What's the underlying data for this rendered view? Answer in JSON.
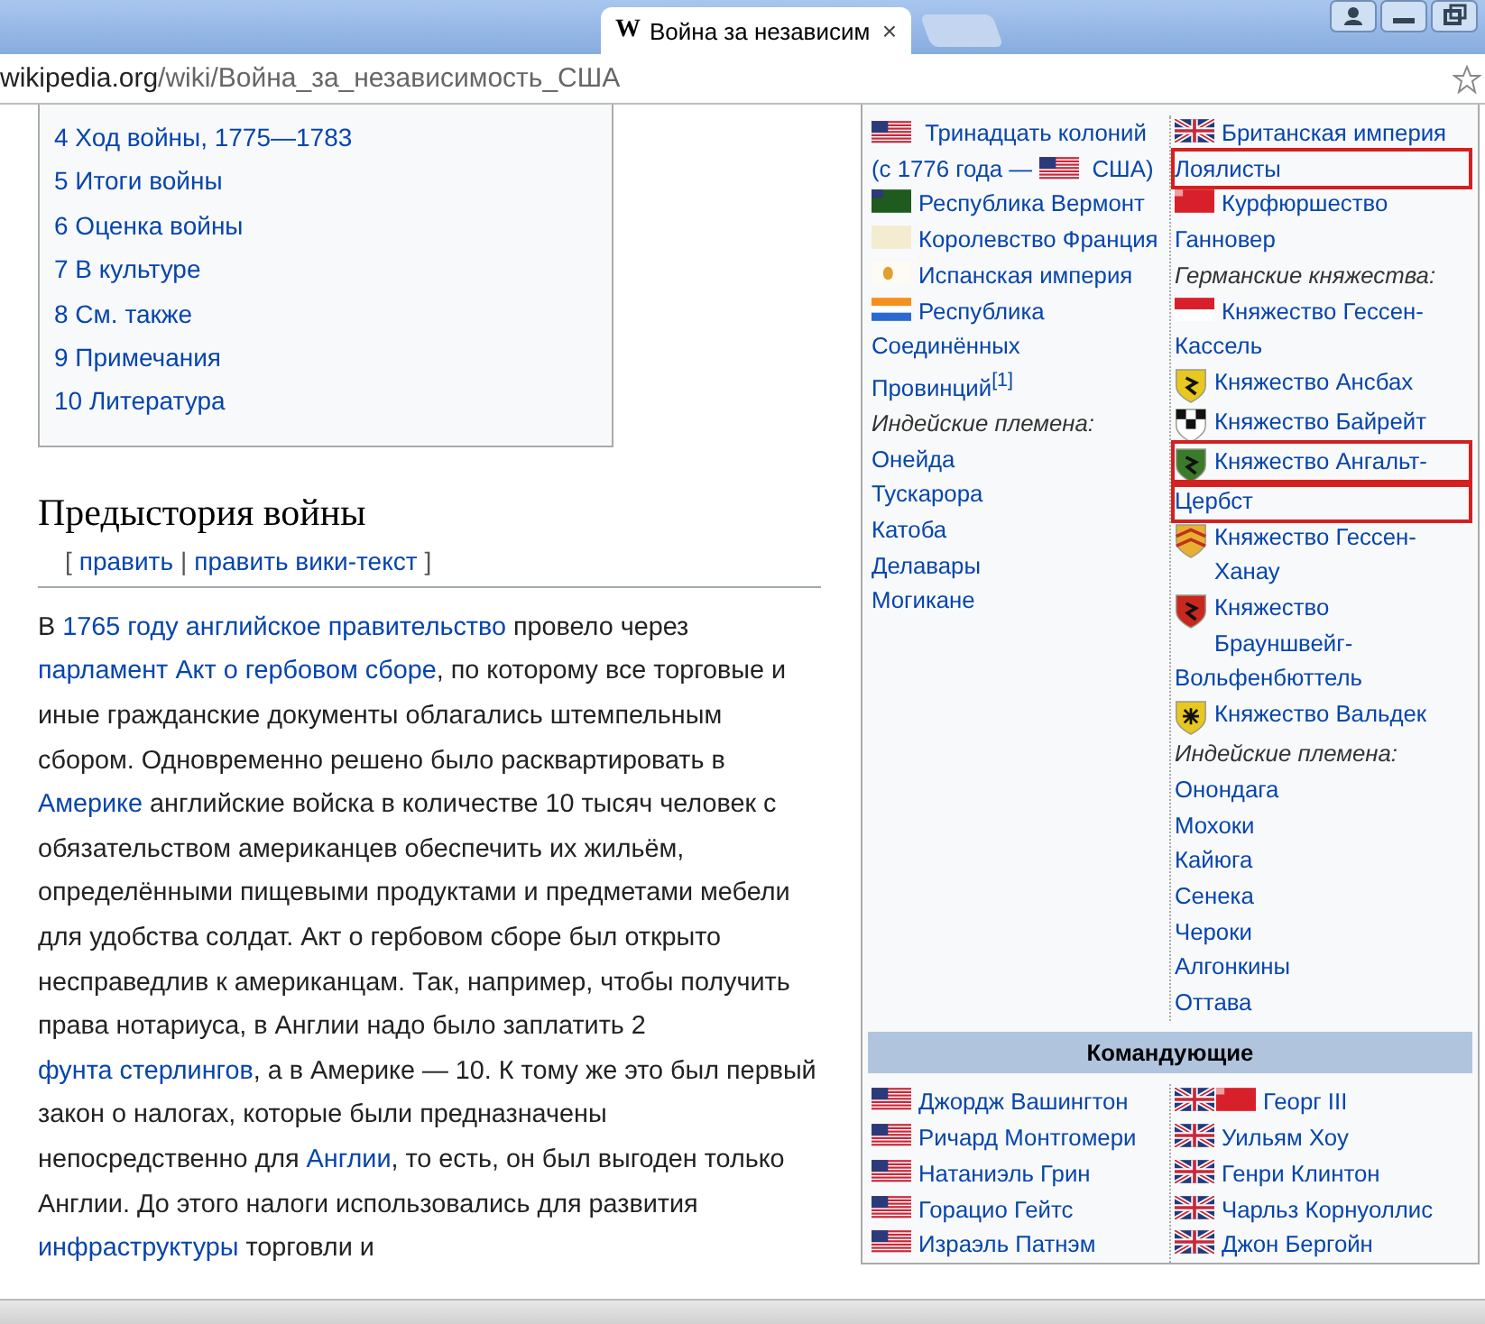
{
  "browser": {
    "tab": {
      "logo": "W",
      "title": "Война за независим",
      "close": "×",
      "selected": true
    },
    "address": {
      "host": "wikipedia.org",
      "path": "/wiki/Война_за_независимость_США"
    }
  },
  "toc": [
    "4 Ход войны, 1775—1783",
    "5 Итоги войны",
    "6 Оценка войны",
    "7 В культуре",
    "8 См. также",
    "9 Примечания",
    "10 Литература"
  ],
  "section": {
    "title": "Предыстория войны",
    "edit": {
      "open": "[",
      "separator": "|",
      "close": "]",
      "links": [
        "править",
        "править вики-текст"
      ]
    },
    "paragraph": [
      {
        "text": "В ",
        "link": false
      },
      {
        "text": "1765 году",
        "link": true,
        "space_after": true
      },
      {
        "text": "английское правительство",
        "link": true
      },
      {
        "text": " провело через ",
        "link": false
      },
      {
        "text": "парламент",
        "link": true,
        "space_after": true
      },
      {
        "text": "Акт о гербовом сборе",
        "link": true
      },
      {
        "text": ", по которому все торговые и иные гражданские документы облагались штемпельным сбором. Одновременно решено было расквартировать в ",
        "link": false
      },
      {
        "text": "Америке",
        "link": true
      },
      {
        "text": " английские войска в количестве 10 тысяч человек с обязательством американцев обеспечить их жильём, определёнными пищевыми продуктами и предметами мебели для удобства солдат. Акт о гербовом сборе был открыто несправедлив к американцам. Так, например, чтобы получить права нотариуса, в Англии надо было заплатить 2 ",
        "link": false
      },
      {
        "text": "фунта стерлингов",
        "link": true
      },
      {
        "text": ", а в Америке — 10. К тому же это был первый закон о налогах, которые были предназначены непосредственно для ",
        "link": false
      },
      {
        "text": "Англии",
        "link": true
      },
      {
        "text": ", то есть, он был выгоден только Англии. До этого налоги использовались для развития ",
        "link": false
      },
      {
        "text": "инфраструктуры",
        "link": true
      },
      {
        "text": " торговли и",
        "link": false
      }
    ]
  },
  "infobox": {
    "sides": [
      {
        "items": [
          {
            "kind": "link",
            "parts": [
              {
                "kind": "us"
              },
              {
                "text": "Тринадцать колоний"
              },
              {
                "text": "(с 1776 года —"
              },
              {
                "kind": "us"
              },
              {
                "text": "США)"
              }
            ],
            "highlighted": false
          },
          {
            "kind": "link",
            "flags": [
              {
                "kind": "vermont"
              }
            ],
            "text": "Республика Вермонт",
            "highlighted": false
          },
          {
            "kind": "link",
            "flags": [
              {
                "kind": "france"
              }
            ],
            "text": "Королевство Франция",
            "highlighted": false
          },
          {
            "kind": "link",
            "flags": [
              {
                "kind": "spain"
              }
            ],
            "text": "Испанская империя",
            "highlighted": false
          },
          {
            "kind": "link",
            "flags": [
              {
                "kind": "dutch"
              }
            ],
            "text": "Республика Соединённых Провинций$^{[1]}$",
            "highlighted": false
          },
          {
            "kind": "heading",
            "text": "Индейские племена:"
          },
          {
            "kind": "link",
            "text": "Онейда",
            "highlighted": false
          },
          {
            "kind": "link",
            "text": "Тускарора",
            "highlighted": false
          },
          {
            "kind": "link",
            "text": "Катоба",
            "highlighted": false
          },
          {
            "kind": "link",
            "text": "Делавары",
            "highlighted": false
          },
          {
            "kind": "link",
            "text": "Могикане",
            "highlighted": false
          }
        ]
      },
      {
        "items": [
          {
            "kind": "link",
            "flags": [
              {
                "kind": "uk"
              }
            ],
            "text": "Британская империя",
            "highlighted": false
          },
          {
            "kind": "link",
            "text": "Лоялисты",
            "highlighted": true
          },
          {
            "kind": "link",
            "flags": [
              {
                "kind": "hanover"
              }
            ],
            "text": "Курфюршество Ганновер",
            "highlighted": false
          },
          {
            "kind": "heading",
            "text": "Германские княжества:"
          },
          {
            "kind": "link",
            "flags": [
              {
                "kind": "hessen"
              }
            ],
            "text": "Княжество Гессен-Кассель",
            "highlighted": false
          },
          {
            "kind": "link",
            "flags": [
              {
                "kind": "ansbach"
              }
            ],
            "text": "Княжество Ансбах",
            "highlighted": false
          },
          {
            "kind": "link",
            "flags": [
              {
                "kind": "bayreuth"
              }
            ],
            "text": "Княжество Байрейт",
            "highlighted": false
          },
          {
            "kind": "link",
            "flags": [
              {
                "kind": "anhalt"
              }
            ],
            "text": "Княжество Ангальт-",
            "highlighted": true
          },
          {
            "kind": "link",
            "text": "Цербст",
            "highlighted": true
          },
          {
            "kind": "link",
            "flags": [
              {
                "kind": "hanau"
              }
            ],
            "text": "Княжество Гессен-Ханау",
            "highlighted": false
          },
          {
            "kind": "link",
            "flags": [
              {
                "kind": "brunswick"
              }
            ],
            "text": "Княжество Брауншвейг-Вольфенбюттель",
            "highlighted": false
          },
          {
            "kind": "link",
            "flags": [
              {
                "kind": "waldeck"
              }
            ],
            "text": "Княжество Вальдек",
            "highlighted": false
          },
          {
            "kind": "heading",
            "text": "Индейские племена:"
          },
          {
            "kind": "link",
            "text": "Онондага",
            "highlighted": false
          },
          {
            "kind": "link",
            "text": "Мохоки",
            "highlighted": false
          },
          {
            "kind": "link",
            "text": "Кайюга",
            "highlighted": false
          },
          {
            "kind": "link",
            "text": "Сенека",
            "highlighted": false
          },
          {
            "kind": "link",
            "text": "Чероки",
            "highlighted": false
          },
          {
            "kind": "link",
            "text": "Алгонкины",
            "highlighted": false
          },
          {
            "kind": "link",
            "text": "Оттава",
            "highlighted": false
          }
        ]
      }
    ],
    "commanders_title": "Командующие",
    "commanders": [
      {
        "items": [
          {
            "kind": "link",
            "flags": [
              {
                "kind": "us"
              }
            ],
            "text": "Джордж Вашингтон",
            "highlighted": false
          },
          {
            "kind": "link",
            "flags": [
              {
                "kind": "us"
              }
            ],
            "text": "Ричард Монтгомери",
            "highlighted": false
          },
          {
            "kind": "link",
            "flags": [
              {
                "kind": "us"
              }
            ],
            "text": "Натаниэль Грин",
            "highlighted": false
          },
          {
            "kind": "link",
            "flags": [
              {
                "kind": "us"
              }
            ],
            "text": "Горацио Гейтс",
            "highlighted": false
          },
          {
            "kind": "link",
            "flags": [
              {
                "kind": "us"
              }
            ],
            "text": "Израэль Патнэм",
            "highlighted": false
          }
        ]
      },
      {
        "items": [
          {
            "kind": "link",
            "flags": [
              {
                "kind": "uk"
              },
              {
                "kind": "hanover"
              }
            ],
            "text": "Георг III",
            "highlighted": false
          },
          {
            "kind": "link",
            "flags": [
              {
                "kind": "uk"
              }
            ],
            "text": "Уильям Хоу",
            "highlighted": false
          },
          {
            "kind": "link",
            "flags": [
              {
                "kind": "uk"
              }
            ],
            "text": "Генри Клинтон",
            "highlighted": false
          },
          {
            "kind": "link",
            "flags": [
              {
                "kind": "uk"
              }
            ],
            "text": "Чарльз Корнуоллис",
            "highlighted": false
          },
          {
            "kind": "link",
            "flags": [
              {
                "kind": "uk"
              }
            ],
            "text": "Джон Бергойн",
            "highlighted": false
          }
        ]
      }
    ]
  }
}
